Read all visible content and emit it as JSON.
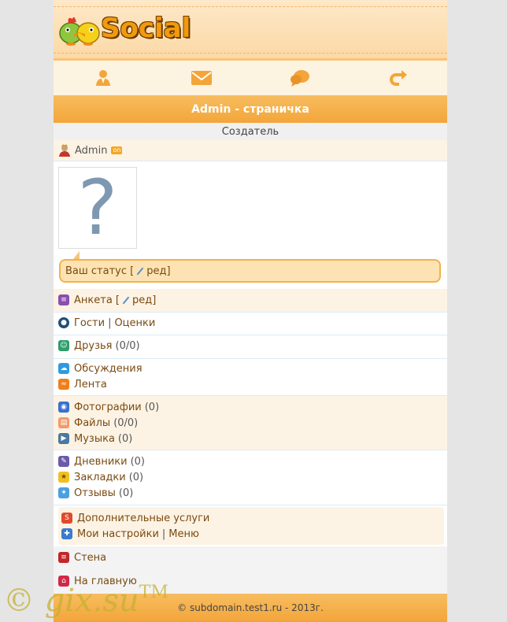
{
  "header": {
    "logo_text": "Social"
  },
  "nav": {
    "items": [
      {
        "icon": "user-icon"
      },
      {
        "icon": "mail-icon"
      },
      {
        "icon": "chat-icon"
      },
      {
        "icon": "exit-icon"
      }
    ]
  },
  "page_title": "Admin - страничка",
  "role_label": "Создатель",
  "user": {
    "name": "Admin",
    "online_badge": "on"
  },
  "avatar": {
    "placeholder": "?"
  },
  "status": {
    "label": "Ваш статус [",
    "edit": "ред",
    "close": "]"
  },
  "menu": {
    "anketa": {
      "label": "Анкета [",
      "edit": "ред",
      "close": "]"
    },
    "guests": {
      "label": "Гости",
      "sep": "|",
      "ratings": "Оценки"
    },
    "friends": {
      "label": "Друзья",
      "count": "(0/0)"
    },
    "discussions": {
      "label": "Обсуждения"
    },
    "feed": {
      "label": "Лента"
    },
    "photos": {
      "label": "Фотографии",
      "count": "(0)"
    },
    "files": {
      "label": "Файлы",
      "count": "(0/0)"
    },
    "music": {
      "label": "Музыка",
      "count": "(0)"
    },
    "diaries": {
      "label": "Дневники",
      "count": "(0)"
    },
    "bookmarks": {
      "label": "Закладки",
      "count": "(0)"
    },
    "reviews": {
      "label": "Отзывы",
      "count": "(0)"
    },
    "services": {
      "label": "Дополнительные услуги"
    },
    "settings": {
      "label": "Мои настройки",
      "sep": "|",
      "menu": "Меню"
    },
    "wall": {
      "label": "Стена"
    },
    "home": {
      "label": "На главную"
    }
  },
  "footer": {
    "text": "© subdomain.test1.ru - 2013г."
  },
  "watermark": {
    "text": "© gix.su",
    "tm": "TM"
  },
  "colors": {
    "accent": "#f3a53a",
    "link": "#7a4a12",
    "alt_row": "#fdf3e4"
  }
}
